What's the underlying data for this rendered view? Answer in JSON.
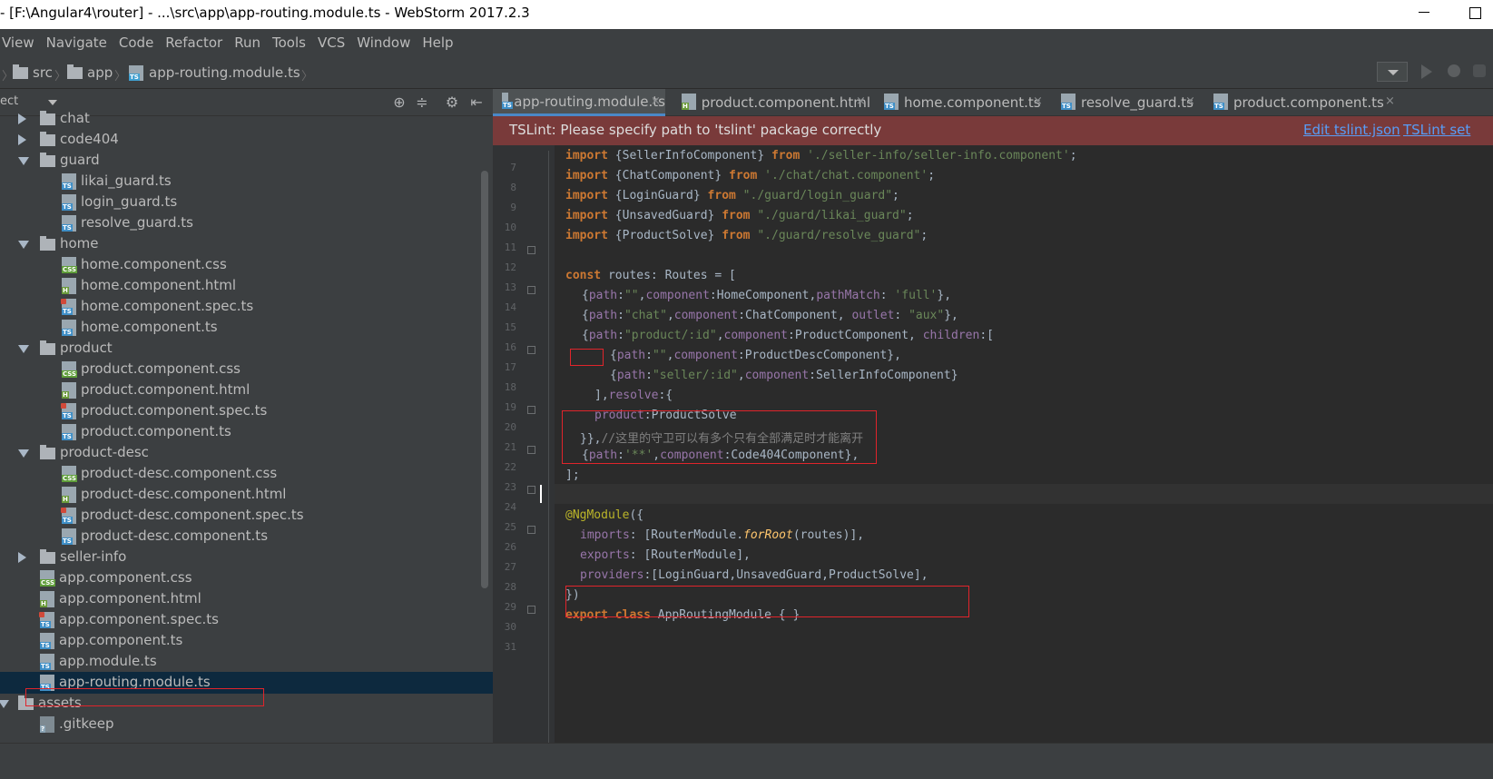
{
  "window": {
    "title": "- [F:\\Angular4\\router] - ...\\src\\app\\app-routing.module.ts - WebStorm 2017.2.3"
  },
  "menu": [
    "View",
    "Navigate",
    "Code",
    "Refactor",
    "Run",
    "Tools",
    "VCS",
    "Window",
    "Help"
  ],
  "breadcrumbs": [
    "src",
    "app",
    "app-routing.module.ts"
  ],
  "project_panel": {
    "header": "ect",
    "tree": [
      {
        "name": "chat",
        "kind": "folder",
        "state": "collapsed"
      },
      {
        "name": "code404",
        "kind": "folder",
        "state": "collapsed"
      },
      {
        "name": "guard",
        "kind": "folder",
        "state": "expanded"
      },
      {
        "name": "likai_guard.ts",
        "kind": "ts"
      },
      {
        "name": "login_guard.ts",
        "kind": "ts"
      },
      {
        "name": "resolve_guard.ts",
        "kind": "ts"
      },
      {
        "name": "home",
        "kind": "folder",
        "state": "expanded"
      },
      {
        "name": "home.component.css",
        "kind": "css"
      },
      {
        "name": "home.component.html",
        "kind": "html"
      },
      {
        "name": "home.component.spec.ts",
        "kind": "spec"
      },
      {
        "name": "home.component.ts",
        "kind": "ts"
      },
      {
        "name": "product",
        "kind": "folder",
        "state": "expanded"
      },
      {
        "name": "product.component.css",
        "kind": "css"
      },
      {
        "name": "product.component.html",
        "kind": "html"
      },
      {
        "name": "product.component.spec.ts",
        "kind": "spec"
      },
      {
        "name": "product.component.ts",
        "kind": "ts"
      },
      {
        "name": "product-desc",
        "kind": "folder",
        "state": "expanded"
      },
      {
        "name": "product-desc.component.css",
        "kind": "css"
      },
      {
        "name": "product-desc.component.html",
        "kind": "html"
      },
      {
        "name": "product-desc.component.spec.ts",
        "kind": "spec"
      },
      {
        "name": "product-desc.component.ts",
        "kind": "ts"
      },
      {
        "name": "seller-info",
        "kind": "folder",
        "state": "collapsed"
      },
      {
        "name": "app.component.css",
        "kind": "css"
      },
      {
        "name": "app.component.html",
        "kind": "html"
      },
      {
        "name": "app.component.spec.ts",
        "kind": "spec"
      },
      {
        "name": "app.component.ts",
        "kind": "ts"
      },
      {
        "name": "app.module.ts",
        "kind": "ts"
      },
      {
        "name": "app-routing.module.ts",
        "kind": "ts",
        "selected": true
      },
      {
        "name": "assets",
        "kind": "folder",
        "state": "expanded"
      },
      {
        "name": ".gitkeep",
        "kind": "git"
      }
    ]
  },
  "tabs": [
    {
      "label": "app-routing.module.ts",
      "active": true
    },
    {
      "label": "product.component.html"
    },
    {
      "label": "home.component.ts"
    },
    {
      "label": "resolve_guard.ts"
    },
    {
      "label": "product.component.ts"
    }
  ],
  "tslint_banner": {
    "message": "TSLint: Please specify path to 'tslint' package correctly",
    "links": [
      "Edit tslint.json",
      "TSLint set"
    ]
  },
  "code": {
    "line_numbers": [
      "7",
      "8",
      "9",
      "10",
      "11",
      "12",
      "13",
      "14",
      "15",
      "16",
      "17",
      "18",
      "19",
      "20",
      "21",
      "22",
      "23",
      "24",
      "25",
      "26",
      "27",
      "28",
      "29",
      "30",
      "31"
    ],
    "lines": {
      "l7": {
        "kw": "import",
        "a": " {SellerInfoComponent} ",
        "kw2": "from",
        "s": " './seller-info/seller-info.component'",
        "e": ";"
      },
      "l8": {
        "kw": "import",
        "a": " {ChatComponent} ",
        "kw2": "from",
        "s": " './chat/chat.component'",
        "e": ";"
      },
      "l9": {
        "kw": "import",
        "a": " {LoginGuard} ",
        "kw2": "from",
        "s": " \"./guard/login_guard\"",
        "e": ";"
      },
      "l10": {
        "kw": "import",
        "a": " {UnsavedGuard} ",
        "kw2": "from",
        "s": " \"./guard/likai_guard\"",
        "e": ";"
      },
      "l11": {
        "kw": "import",
        "a": " {ProductSolve} ",
        "kw2": "from",
        "s": " \"./guard/resolve_guard\"",
        "e": ";"
      },
      "l13": {
        "kw": "const",
        "a": " routes: Routes = ["
      },
      "l14": {
        "a": "{",
        "p1": "path",
        "b": ":",
        "s1": "\"\"",
        "c": ",",
        "p2": "component",
        "d": ":HomeComponent,",
        "p3": "pathMatch",
        "e": ": ",
        "s2": "'full'",
        "f": "},"
      },
      "l15": {
        "a": "{",
        "p1": "path",
        "b": ":",
        "s1": "\"chat\"",
        "c": ",",
        "p2": "component",
        "d": ":ChatComponent, ",
        "p3": "outlet",
        "e": ": ",
        "s2": "\"aux\"",
        "f": "},"
      },
      "l16": {
        "a": "{",
        "p1": "path",
        "b": ":",
        "s1": "\"product/:id\"",
        "c": ",",
        "p2": "component",
        "d": ":ProductComponent, ",
        "p3": "children",
        "e": ":["
      },
      "l17": {
        "a": "{",
        "p1": "path",
        "b": ":",
        "s1": "\"\"",
        "c": ",",
        "p2": "component",
        "d": ":ProductDescComponent},"
      },
      "l18": {
        "a": "{",
        "p1": "path",
        "b": ":",
        "s1": "\"seller/:id\"",
        "c": ",",
        "p2": "component",
        "d": ":SellerInfoComponent}"
      },
      "l19": {
        "a": "],",
        "p1": "resolve",
        "b": ":{"
      },
      "l20": {
        "p1": "product",
        "b": ":ProductSolve"
      },
      "l21": {
        "a": "}},",
        "cmt": "//这里的守卫可以有多个只有全部满足时才能离开"
      },
      "l22": {
        "a": "{",
        "p1": "path",
        "b": ":",
        "s1": "'**'",
        "c": ",",
        "p2": "component",
        "d": ":Code404Component},"
      },
      "l23": {
        "a": "];"
      },
      "l25": {
        "ann": "@NgModule",
        "a": "({"
      },
      "l26": {
        "p1": "imports",
        "a": ": [RouterModule.",
        "fn": "forRoot",
        "b": "(routes)],"
      },
      "l27": {
        "p1": "exports",
        "a": ": [RouterModule],"
      },
      "l28": {
        "p1": "providers",
        "a": ":[LoginGuard,UnsavedGuard,ProductSolve],"
      },
      "l29": {
        "a": "})"
      },
      "l30": {
        "kw": "export class",
        "a": " AppRoutingModule { }"
      }
    }
  },
  "colors": {
    "keyword": "#cc7832",
    "string": "#6a8759",
    "property": "#9876aa",
    "annotation": "#bbb529",
    "function": "#ffc66d",
    "comment": "#808080",
    "banner": "#793a3a",
    "highlight_box": "#e0242b",
    "selection": "#0d293e"
  },
  "icons": [
    "folder-icon",
    "typescript-file-icon",
    "css-file-icon",
    "html-file-icon",
    "spec-file-icon",
    "gitkeep-file-icon",
    "locate-icon",
    "collapse-all-icon",
    "gear-icon",
    "hide-panel-icon",
    "run-icon",
    "debug-icon",
    "coverage-icon",
    "close-icon"
  ]
}
